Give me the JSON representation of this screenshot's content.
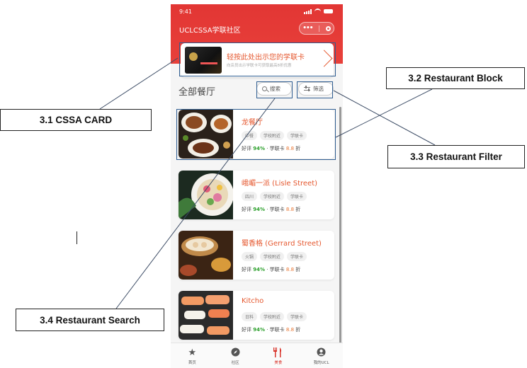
{
  "status_bar": {
    "time": "9:41"
  },
  "app": {
    "title": "UCLCSSA学联社区"
  },
  "cssa_card": {
    "title": "轻按此处出示您的学联卡",
    "subtitle": "向店员出示学联卡可获取最高8折优惠"
  },
  "section": {
    "title": "全部餐厅",
    "search_label": "搜索",
    "filter_label": "筛选"
  },
  "restaurants": [
    {
      "name": "龙餐厅",
      "tags": [
        "中餐",
        "学校附近",
        "学联卡"
      ],
      "rating_prefix": "好评",
      "rating": "94%",
      "discount_prefix": "· 学联卡",
      "discount": "8.8",
      "discount_suffix": "折"
    },
    {
      "name": "峨嵋一派 (Lisle Street)",
      "tags": [
        "四川",
        "学校附近",
        "学联卡"
      ],
      "rating_prefix": "好评",
      "rating": "94%",
      "discount_prefix": "· 学联卡",
      "discount": "8.8",
      "discount_suffix": "折"
    },
    {
      "name": "蜀香格 (Gerrard Street)",
      "tags": [
        "火锅",
        "学校附近",
        "学联卡"
      ],
      "rating_prefix": "好评",
      "rating": "94%",
      "discount_prefix": "· 学联卡",
      "discount": "8.8",
      "discount_suffix": "折"
    },
    {
      "name": "Kitcho",
      "tags": [
        "日料",
        "学校附近",
        "学联卡"
      ],
      "rating_prefix": "好评",
      "rating": "94%",
      "discount_prefix": "· 学联卡",
      "discount": "8.8",
      "discount_suffix": "折"
    }
  ],
  "tabbar": [
    {
      "label": "首页",
      "icon": "star-icon"
    },
    {
      "label": "社区",
      "icon": "compass-icon"
    },
    {
      "label": "美食",
      "icon": "fork-knife-icon",
      "active": true
    },
    {
      "label": "我的UCL",
      "icon": "user-icon"
    }
  ],
  "annotations": {
    "cssa_card": "3.1 CSSA CARD",
    "restaurant_block": "3.2 Restaurant Block",
    "restaurant_filter": "3.3 Restaurant Filter",
    "restaurant_search": "3.4 Restaurant Search"
  },
  "colors": {
    "brand_red": "#e23634",
    "accent_orange": "#e5572e",
    "rating_green": "#2ca02c",
    "annotation_blue": "#2f5d91"
  }
}
